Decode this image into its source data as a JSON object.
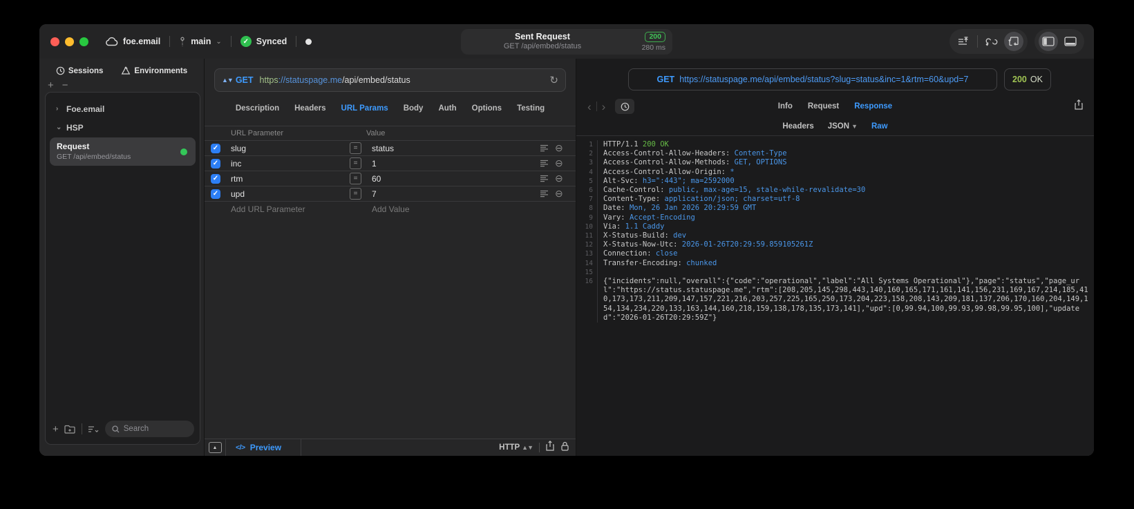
{
  "colors": {
    "accent_blue": "#3e9bff",
    "status_green": "#34c759",
    "badge_green": "#40c457",
    "response_value_blue": "#4a96e8",
    "response_green": "#66bb46",
    "url_scheme_green": "#a3c28a",
    "checkbox_blue": "#2d7ff5",
    "status_200_olive": "#9fc353"
  },
  "titlebar": {
    "project": "foe.email",
    "branch": "main",
    "sync_status": "Synced",
    "sent_request": {
      "title": "Sent Request",
      "subtitle": "GET /api/embed/status",
      "status_code": "200",
      "duration": "280 ms"
    }
  },
  "sidebar": {
    "tabs": [
      {
        "label": "Sessions"
      },
      {
        "label": "Environments"
      }
    ],
    "tree": [
      {
        "label": "Foe.email",
        "state": "collapsed"
      },
      {
        "label": "HSP",
        "state": "expanded"
      }
    ],
    "request_item": {
      "title": "Request",
      "subtitle": "GET /api/embed/status"
    },
    "search_placeholder": "Search"
  },
  "request_panel": {
    "method": "GET",
    "url": {
      "scheme": "https",
      "host": "://statuspage.me",
      "path": "/api/embed/status"
    },
    "tabs": [
      "Description",
      "Headers",
      "URL Params",
      "Body",
      "Auth",
      "Options",
      "Testing"
    ],
    "active_tab": "URL Params",
    "params": {
      "columns": [
        "URL Parameter",
        "Value"
      ],
      "rows": [
        {
          "name": "slug",
          "value": "status",
          "enabled": true
        },
        {
          "name": "inc",
          "value": "1",
          "enabled": true
        },
        {
          "name": "rtm",
          "value": "60",
          "enabled": true
        },
        {
          "name": "upd",
          "value": "7",
          "enabled": true
        }
      ],
      "add_name_placeholder": "Add URL Parameter",
      "add_value_placeholder": "Add Value"
    },
    "footer": {
      "code_glyph": "</>",
      "preview_label": "Preview",
      "protocol": "HTTP"
    }
  },
  "response_panel": {
    "method": "GET",
    "url": "https://statuspage.me/api/embed/status?slug=status&inc=1&rtm=60&upd=7",
    "status_code": "200",
    "status_text": "OK",
    "tabs": [
      "Info",
      "Request",
      "Response"
    ],
    "active_tab": "Response",
    "subtabs": [
      {
        "label": "Headers"
      },
      {
        "label": "JSON",
        "dropdown": true
      },
      {
        "label": "Raw"
      }
    ],
    "active_subtab": "Raw",
    "body_lines": [
      {
        "n": "1",
        "segs": [
          {
            "c": "w",
            "t": "HTTP/1.1 "
          },
          {
            "c": "g",
            "t": "200 OK"
          }
        ]
      },
      {
        "n": "2",
        "segs": [
          {
            "c": "w",
            "t": "Access-Control-Allow-Headers: "
          },
          {
            "c": "b",
            "t": "Content-Type"
          }
        ]
      },
      {
        "n": "3",
        "segs": [
          {
            "c": "w",
            "t": "Access-Control-Allow-Methods: "
          },
          {
            "c": "b",
            "t": "GET, OPTIONS"
          }
        ]
      },
      {
        "n": "4",
        "segs": [
          {
            "c": "w",
            "t": "Access-Control-Allow-Origin: "
          },
          {
            "c": "b",
            "t": "*"
          }
        ]
      },
      {
        "n": "5",
        "segs": [
          {
            "c": "w",
            "t": "Alt-Svc: "
          },
          {
            "c": "b",
            "t": "h3=\":443\"; ma=2592000"
          }
        ]
      },
      {
        "n": "6",
        "segs": [
          {
            "c": "w",
            "t": "Cache-Control: "
          },
          {
            "c": "b",
            "t": "public, max-age=15, stale-while-revalidate=30"
          }
        ]
      },
      {
        "n": "7",
        "segs": [
          {
            "c": "w",
            "t": "Content-Type: "
          },
          {
            "c": "b",
            "t": "application/json; charset=utf-8"
          }
        ]
      },
      {
        "n": "8",
        "segs": [
          {
            "c": "w",
            "t": "Date: "
          },
          {
            "c": "b",
            "t": "Mon, 26 Jan 2026 20:29:59 GMT"
          }
        ]
      },
      {
        "n": "9",
        "segs": [
          {
            "c": "w",
            "t": "Vary: "
          },
          {
            "c": "b",
            "t": "Accept-Encoding"
          }
        ]
      },
      {
        "n": "10",
        "segs": [
          {
            "c": "w",
            "t": "Via: "
          },
          {
            "c": "b",
            "t": "1.1 Caddy"
          }
        ]
      },
      {
        "n": "11",
        "segs": [
          {
            "c": "w",
            "t": "X-Status-Build: "
          },
          {
            "c": "b",
            "t": "dev"
          }
        ]
      },
      {
        "n": "12",
        "segs": [
          {
            "c": "w",
            "t": "X-Status-Now-Utc: "
          },
          {
            "c": "b",
            "t": "2026-01-26T20:29:59.859105261Z"
          }
        ]
      },
      {
        "n": "13",
        "segs": [
          {
            "c": "w",
            "t": "Connection: "
          },
          {
            "c": "b",
            "t": "close"
          }
        ]
      },
      {
        "n": "14",
        "segs": [
          {
            "c": "w",
            "t": "Transfer-Encoding: "
          },
          {
            "c": "b",
            "t": "chunked"
          }
        ]
      },
      {
        "n": "15",
        "segs": []
      },
      {
        "n": "16",
        "segs": [
          {
            "c": "w",
            "t": "{\"incidents\":null,\"overall\":{\"code\":\"operational\",\"label\":\"All Systems Operational\"},\"page\":\"status\",\"page_url\":\"https://status.statuspage.me\",\"rtm\":[208,205,145,298,443,140,160,165,171,161,141,156,231,169,167,214,185,410,173,173,211,209,147,157,221,216,203,257,225,165,250,173,204,223,158,208,143,209,181,137,206,170,160,204,149,154,134,234,220,133,163,144,160,218,159,138,178,135,173,141],\"upd\":[0,99.94,100,99.93,99.98,99.95,100],\"updated\":\"2026-01-26T20:29:59Z\"}"
          }
        ]
      }
    ]
  }
}
